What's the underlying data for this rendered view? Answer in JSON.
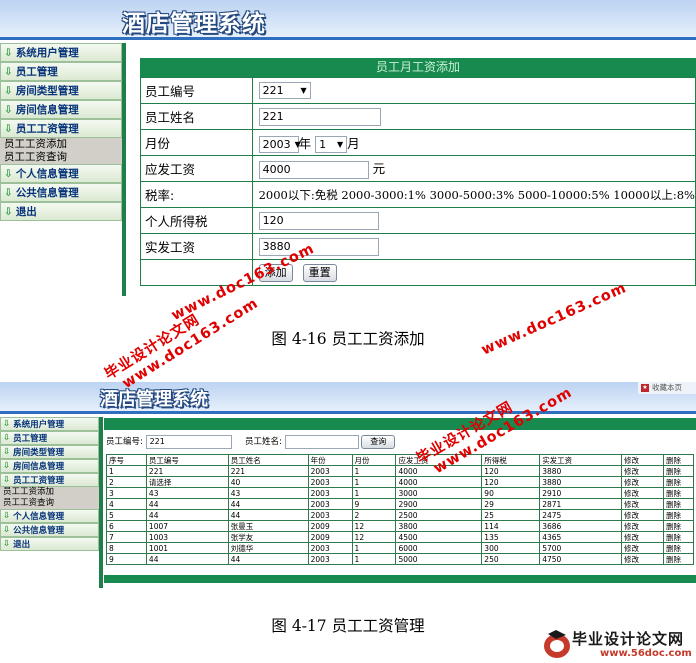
{
  "app_title": "酒店管理系统",
  "nav": [
    {
      "label": "系统用户管理"
    },
    {
      "label": "员工管理"
    },
    {
      "label": "房间类型管理"
    },
    {
      "label": "房间信息管理"
    },
    {
      "label": "员工工资管理"
    },
    {
      "label": "个人信息管理"
    },
    {
      "label": "公共信息管理"
    },
    {
      "label": "退出"
    }
  ],
  "nav_sub": [
    "员工工资添加",
    "员工工资查询"
  ],
  "form": {
    "header": "员工月工资添加",
    "emp_id_label": "员工编号",
    "emp_id_value": "221",
    "emp_name_label": "员工姓名",
    "emp_name_value": "221",
    "month_label": "月份",
    "year_value": "2003",
    "year_unit": "年",
    "month_value": "1",
    "month_unit": "月",
    "salary_label": "应发工资",
    "salary_value": "4000",
    "salary_unit": "元",
    "tax_rate_label": "税率:",
    "tax_rate_text": "2000以下:免税  2000-3000:1% 3000-5000:3% 5000-10000:5% 10000以上:8%",
    "tax_label": "个人所得税",
    "tax_value": "120",
    "net_label": "实发工资",
    "net_value": "3880",
    "add_button": "添加",
    "reset_button": "重置"
  },
  "caption_1": "图 4-16 员工工资添加",
  "caption_2": "图 4-17 员工工资管理",
  "list": {
    "top_right_text": "收藏本页",
    "search_id_label": "员工编号:",
    "search_id_value": "221",
    "search_name_label": "员工姓名:",
    "search_name_value": "",
    "search_button": "查询",
    "columns": [
      "序号",
      "员工编号",
      "员工姓名",
      "年份",
      "月份",
      "应发工资",
      "所得税",
      "实发工资",
      "修改",
      "删除"
    ],
    "rows": [
      [
        "1",
        "221",
        "221",
        "2003",
        "1",
        "4000",
        "120",
        "3880",
        "修改",
        "删除"
      ],
      [
        "2",
        "请选择",
        "40",
        "2003",
        "1",
        "4000",
        "120",
        "3880",
        "修改",
        "删除"
      ],
      [
        "3",
        "43",
        "43",
        "2003",
        "1",
        "3000",
        "90",
        "2910",
        "修改",
        "删除"
      ],
      [
        "4",
        "44",
        "44",
        "2003",
        "9",
        "2900",
        "29",
        "2871",
        "修改",
        "删除"
      ],
      [
        "5",
        "44",
        "44",
        "2003",
        "2",
        "2500",
        "25",
        "2475",
        "修改",
        "删除"
      ],
      [
        "6",
        "1007",
        "张曼玉",
        "2009",
        "12",
        "3800",
        "114",
        "3686",
        "修改",
        "删除"
      ],
      [
        "7",
        "1003",
        "张学友",
        "2009",
        "12",
        "4500",
        "135",
        "4365",
        "修改",
        "删除"
      ],
      [
        "8",
        "1001",
        "刘德华",
        "2003",
        "1",
        "6000",
        "300",
        "5700",
        "修改",
        "删除"
      ],
      [
        "9",
        "44",
        "44",
        "2003",
        "1",
        "5000",
        "250",
        "4750",
        "修改",
        "删除"
      ]
    ]
  },
  "watermark": {
    "line1": "毕业设计论文网",
    "line2": "www.doc163.com"
  },
  "stamp": {
    "title": "毕业设计论文网",
    "url": "www.56doc.com"
  },
  "colors": {
    "sidebar_border": "#1e7f4a",
    "header_band": "#188a4f",
    "watermark": "#e00000",
    "header_bg": "#bcd3f2"
  }
}
